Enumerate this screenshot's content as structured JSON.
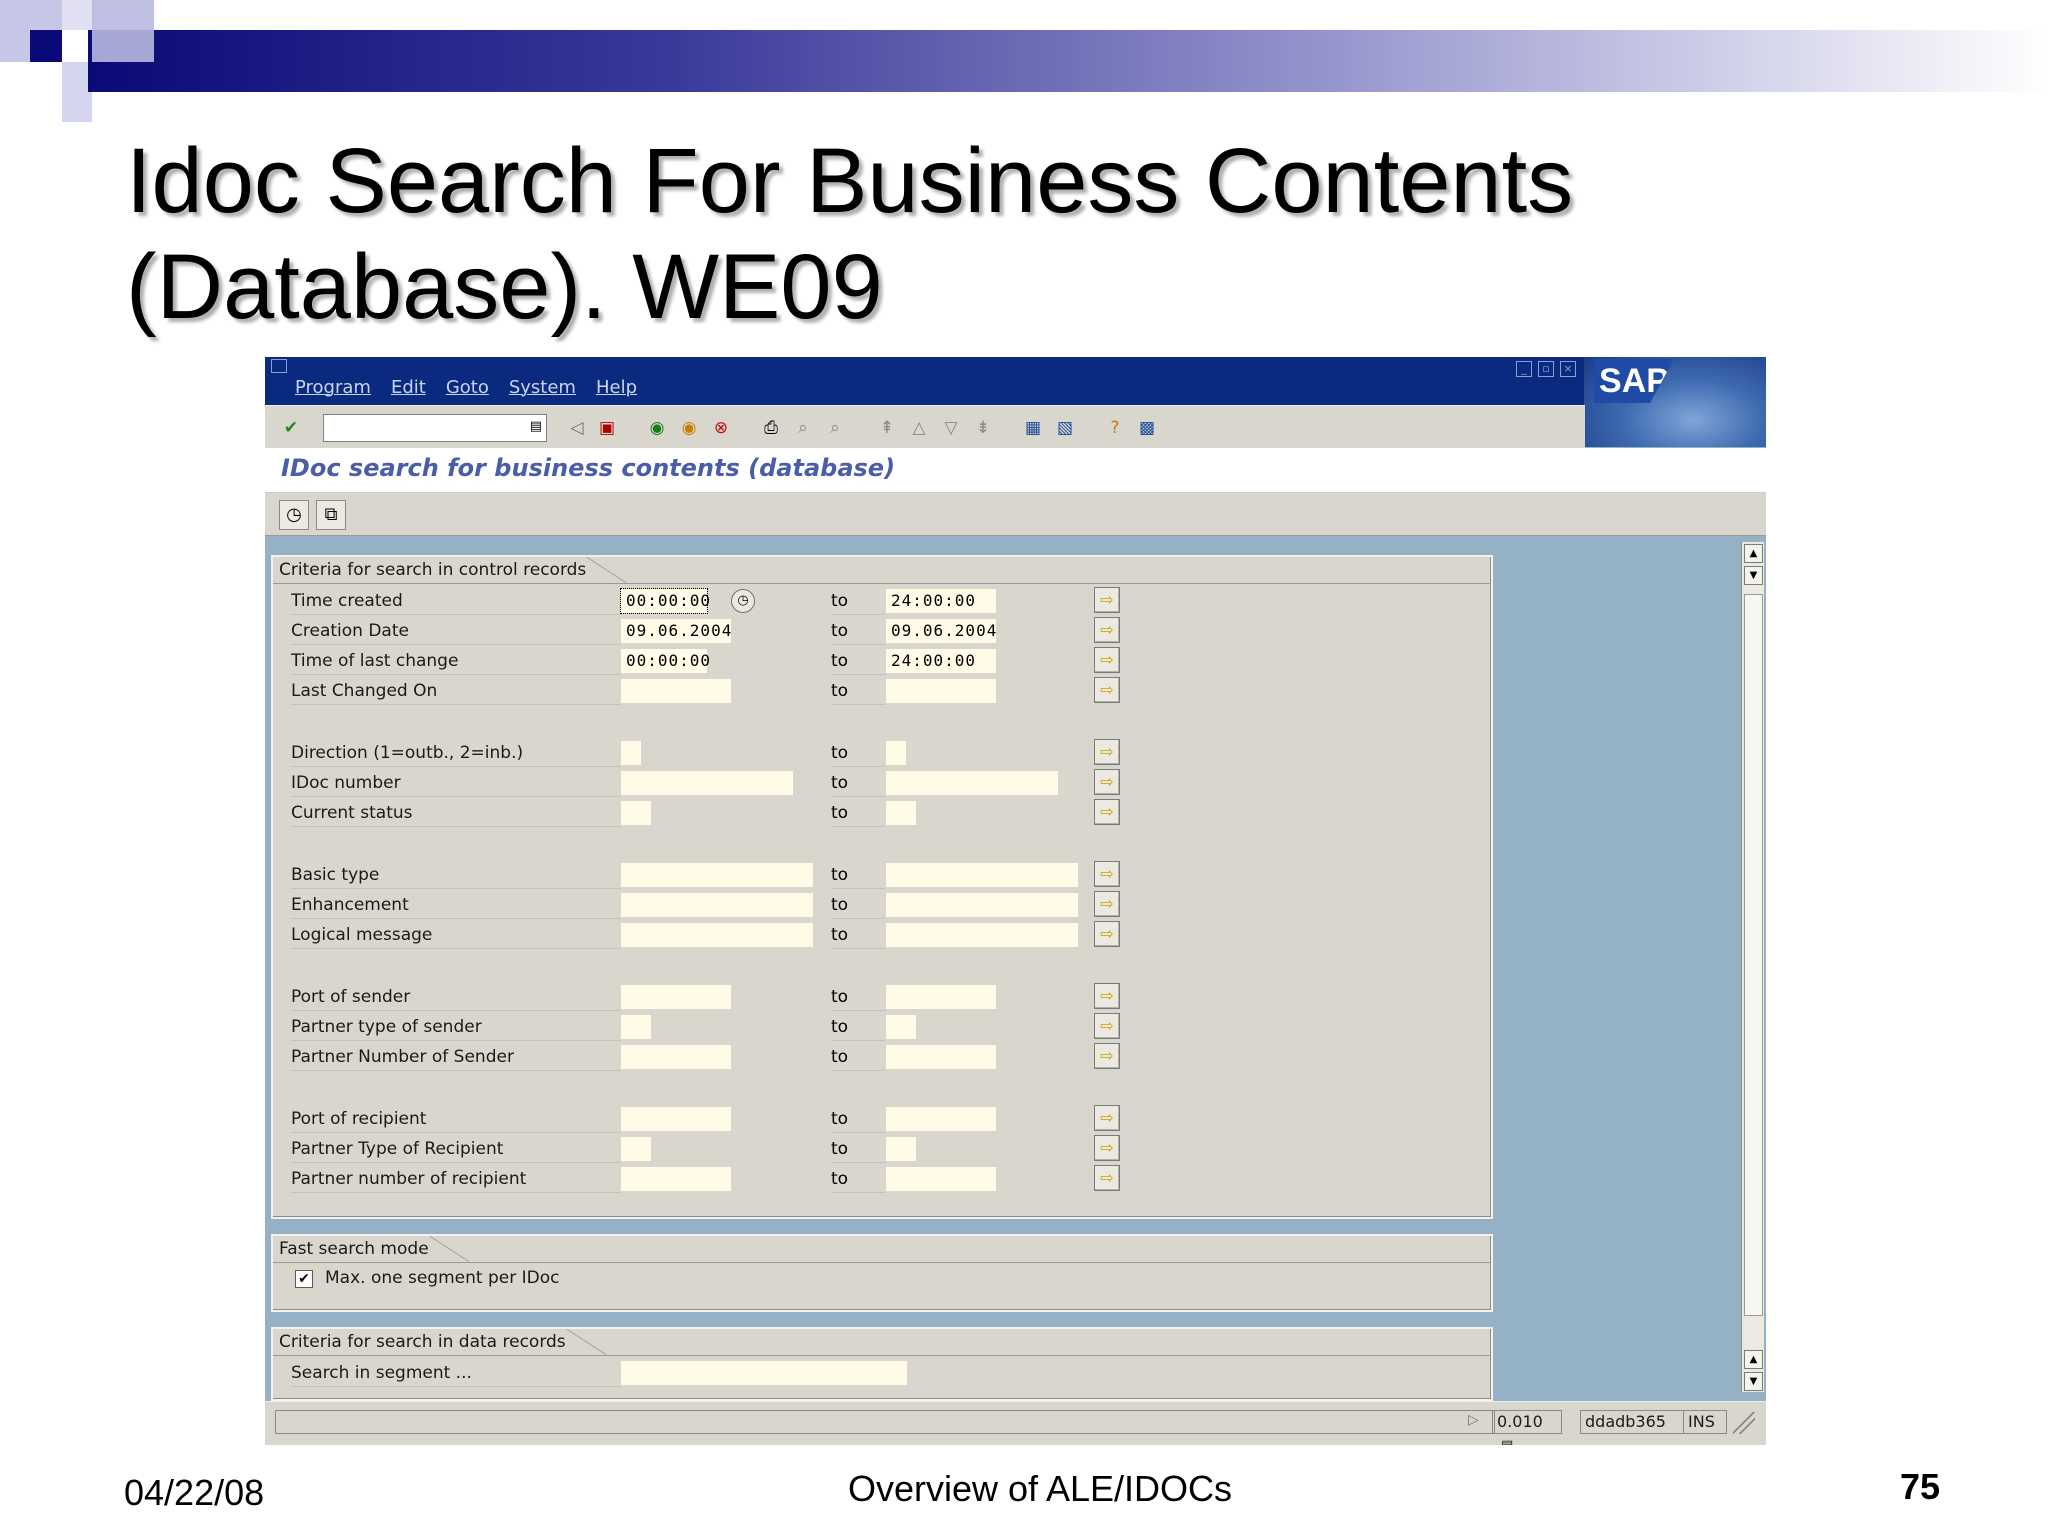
{
  "slide": {
    "title_line1": "Idoc Search For Business Contents",
    "title_line2": "(Database). WE09",
    "date": "04/22/08",
    "footer": "Overview of ALE/IDOCs",
    "page_number": "75"
  },
  "window": {
    "menu": [
      "Program",
      "Edit",
      "Goto",
      "System",
      "Help"
    ],
    "logo_text": "SAP",
    "screen_title": "IDoc search for business contents (database)",
    "toolbar_icons": [
      "enter-icon",
      "command-field",
      "back-icon",
      "save-icon",
      "back-green-icon",
      "exit-icon",
      "cancel-icon",
      "print-icon",
      "find-icon",
      "find-next-icon",
      "first-page-icon",
      "prev-page-icon",
      "next-page-icon",
      "last-page-icon",
      "create-session-icon",
      "shortcut-icon",
      "help-icon",
      "customize-layout-icon"
    ],
    "app_toolbar_icons": [
      "execute-icon",
      "copy-icon"
    ]
  },
  "control_criteria": {
    "title": "Criteria for search in control records",
    "to_label": "to",
    "fields": [
      {
        "label": "Time created",
        "from": "00:00:00",
        "to": "24:00:00"
      },
      {
        "label": "Creation Date",
        "from": "09.06.2004",
        "to": "09.06.2004"
      },
      {
        "label": "Time of last change",
        "from": "00:00:00",
        "to": "24:00:00"
      },
      {
        "label": "Last Changed On",
        "from": "",
        "to": ""
      },
      {
        "label": "Direction (1=outb., 2=inb.)",
        "from": "",
        "to": ""
      },
      {
        "label": "IDoc number",
        "from": "",
        "to": ""
      },
      {
        "label": "Current status",
        "from": "",
        "to": ""
      },
      {
        "label": "Basic type",
        "from": "",
        "to": ""
      },
      {
        "label": "Enhancement",
        "from": "",
        "to": ""
      },
      {
        "label": "Logical message",
        "from": "",
        "to": ""
      },
      {
        "label": "Port of sender",
        "from": "",
        "to": ""
      },
      {
        "label": "Partner type of sender",
        "from": "",
        "to": ""
      },
      {
        "label": "Partner Number of Sender",
        "from": "",
        "to": ""
      },
      {
        "label": "Port of recipient",
        "from": "",
        "to": ""
      },
      {
        "label": "Partner Type of Recipient",
        "from": "",
        "to": ""
      },
      {
        "label": "Partner number of recipient",
        "from": "",
        "to": ""
      }
    ]
  },
  "fast_search": {
    "title": "Fast search mode",
    "checkbox_label": "Max. one segment per IDoc",
    "checked": true
  },
  "data_criteria": {
    "title": "Criteria for search in data records",
    "field_label": "Search in segment ...",
    "value": ""
  },
  "status_bar": {
    "response_time": "0.010",
    "server": "ddadb365",
    "mode": "INS"
  },
  "colors": {
    "banner_dark": "#0a0a78",
    "window_top": "#0a2a80",
    "panel": "#d9d6cd",
    "background": "#95b1c6",
    "screen_title": "#4a5ea8",
    "input": "#fffbe6"
  }
}
